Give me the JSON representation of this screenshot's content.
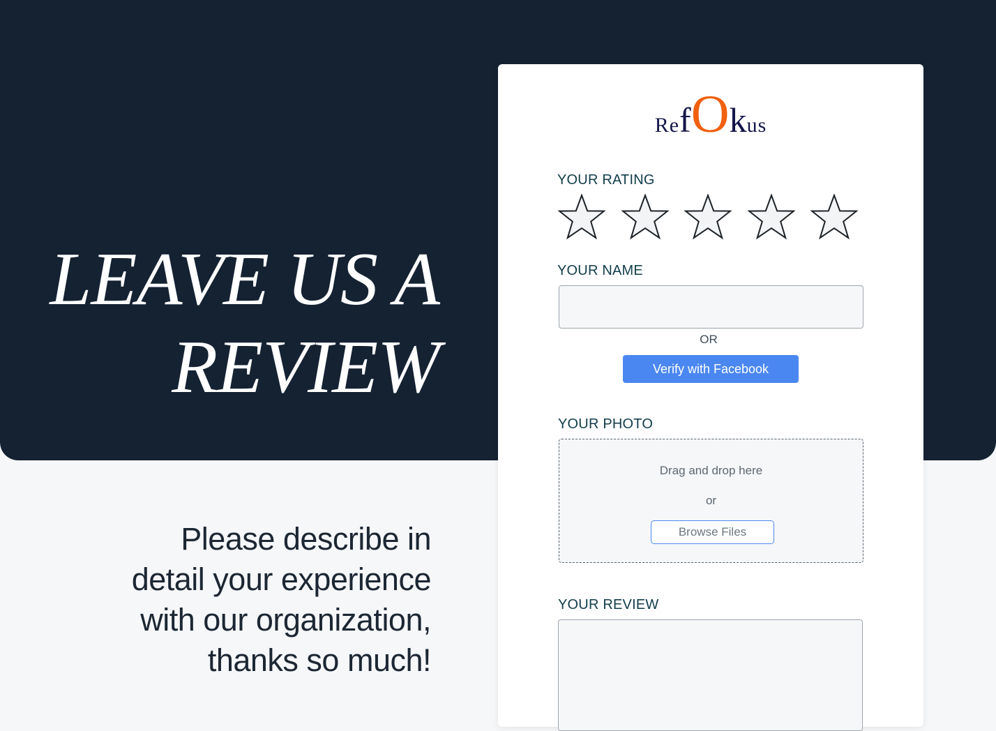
{
  "hero": {
    "title_line1": "LEAVE US A",
    "title_line2": "REVIEW",
    "background_color": "#142232"
  },
  "intro": {
    "line1": "Please describe in",
    "line2": "detail your experience",
    "line3": "with our organization,",
    "line4": "thanks so much!"
  },
  "logo": {
    "part_re": "Re",
    "part_f": "f",
    "part_o": "O",
    "part_k": "k",
    "part_us": "us",
    "accent_color": "#f0600f",
    "text_color": "#14164a"
  },
  "form": {
    "rating": {
      "label": "YOUR RATING",
      "max": 5,
      "value": 0,
      "icon": "star-outline-icon"
    },
    "name": {
      "label": "YOUR NAME",
      "value": "",
      "placeholder": ""
    },
    "or_label": "OR",
    "facebook_button": {
      "label": "Verify with Facebook",
      "color": "#4b87f0"
    },
    "photo": {
      "label": "YOUR PHOTO",
      "drag_text": "Drag and drop here",
      "or_text": "or",
      "browse_label": "Browse Files"
    },
    "review": {
      "label": "YOUR REVIEW",
      "value": "",
      "placeholder": ""
    }
  }
}
